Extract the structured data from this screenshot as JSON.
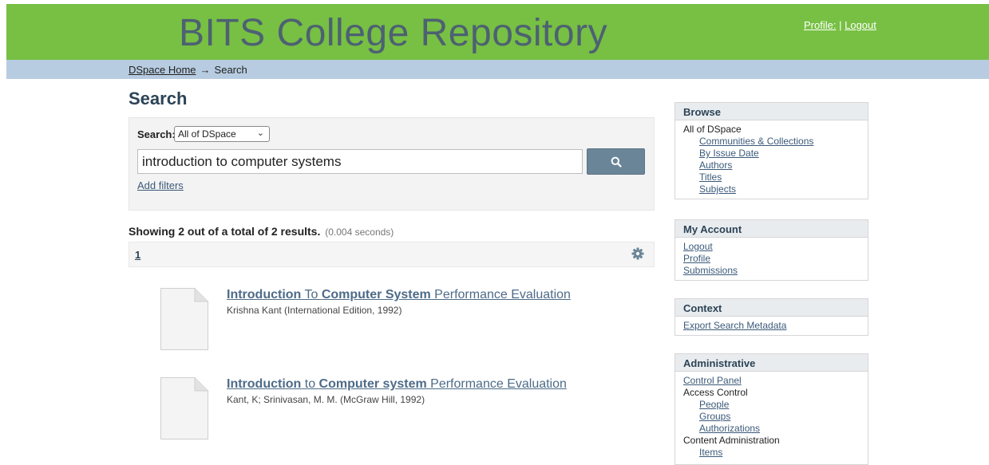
{
  "header": {
    "site_title": "BITS College Repository",
    "profile_link": "Profile:",
    "separator": "|",
    "logout_link": "Logout"
  },
  "breadcrumb": {
    "home": "DSpace Home",
    "arrow": "→",
    "current": "Search"
  },
  "main": {
    "title": "Search",
    "search": {
      "scope_label": "Search:",
      "scope_value": "All of DSpace",
      "query_value": "introduction to computer systems",
      "add_filters": "Add filters"
    },
    "results_summary": "Showing 2 out of a total of 2 results.",
    "results_time": "(0.004 seconds)",
    "pager": {
      "current_page": "1"
    },
    "results": [
      {
        "title_parts": [
          "Introduction",
          " To ",
          "Computer System",
          " Performance Evaluation"
        ],
        "meta": "Krishna Kant (International Edition, 1992)"
      },
      {
        "title_parts": [
          "Introduction",
          " to ",
          "Computer system",
          " Performance Evaluation"
        ],
        "meta": "Kant, K; Srinivasan, M. M. (McGraw Hill, 1992)"
      }
    ]
  },
  "sidebar": {
    "browse": {
      "heading": "Browse",
      "group": "All of DSpace",
      "links": [
        "Communities & Collections",
        "By Issue Date",
        "Authors",
        "Titles",
        "Subjects"
      ]
    },
    "account": {
      "heading": "My Account",
      "links": [
        "Logout",
        "Profile",
        "Submissions"
      ]
    },
    "context": {
      "heading": "Context",
      "links": [
        "Export Search Metadata"
      ]
    },
    "admin": {
      "heading": "Administrative",
      "control_panel": "Control Panel",
      "access_control": "Access Control",
      "access_links": [
        "People",
        "Groups",
        "Authorizations"
      ],
      "content_admin": "Content Administration",
      "content_links": [
        "Items"
      ]
    }
  },
  "colors": {
    "header_bg": "#77c043",
    "title_text": "#4d6172",
    "breadcrumb_bg": "#b7cce1",
    "search_button": "#6a8597"
  }
}
